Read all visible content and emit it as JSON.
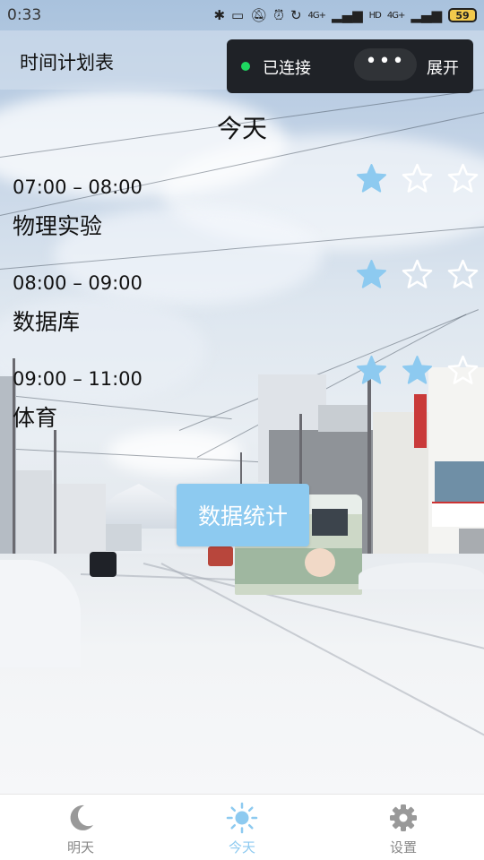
{
  "status_bar": {
    "time": "0:33",
    "network_1": "4G+",
    "network_2": "4G+",
    "hd": "HD",
    "battery": "59"
  },
  "app_bar": {
    "title": "时间计划表"
  },
  "capsule": {
    "status": "已连接",
    "more": "•••",
    "expand": "展开",
    "status_color": "#1ed760"
  },
  "main": {
    "day_title": "今天",
    "items": [
      {
        "time": "07:00 – 08:00",
        "name": "物理实验",
        "rating": 1,
        "max_rating": 3
      },
      {
        "time": "08:00 – 09:00",
        "name": "数据库",
        "rating": 1,
        "max_rating": 3
      },
      {
        "time": "09:00 – 11:00",
        "name": "体育",
        "rating": 2,
        "max_rating": 3
      }
    ],
    "stats_button": "数据统计"
  },
  "tabbar": {
    "tabs": [
      {
        "label": "明天",
        "icon": "moon-icon",
        "active": false
      },
      {
        "label": "今天",
        "icon": "sun-icon",
        "active": true
      },
      {
        "label": "设置",
        "icon": "gear-icon",
        "active": false
      }
    ]
  },
  "colors": {
    "accent": "#8dcaf0",
    "star_filled": "#8dcaf0",
    "star_empty": "#ffffff",
    "tab_inactive": "#888888",
    "capsule_bg": "#1f2227"
  }
}
